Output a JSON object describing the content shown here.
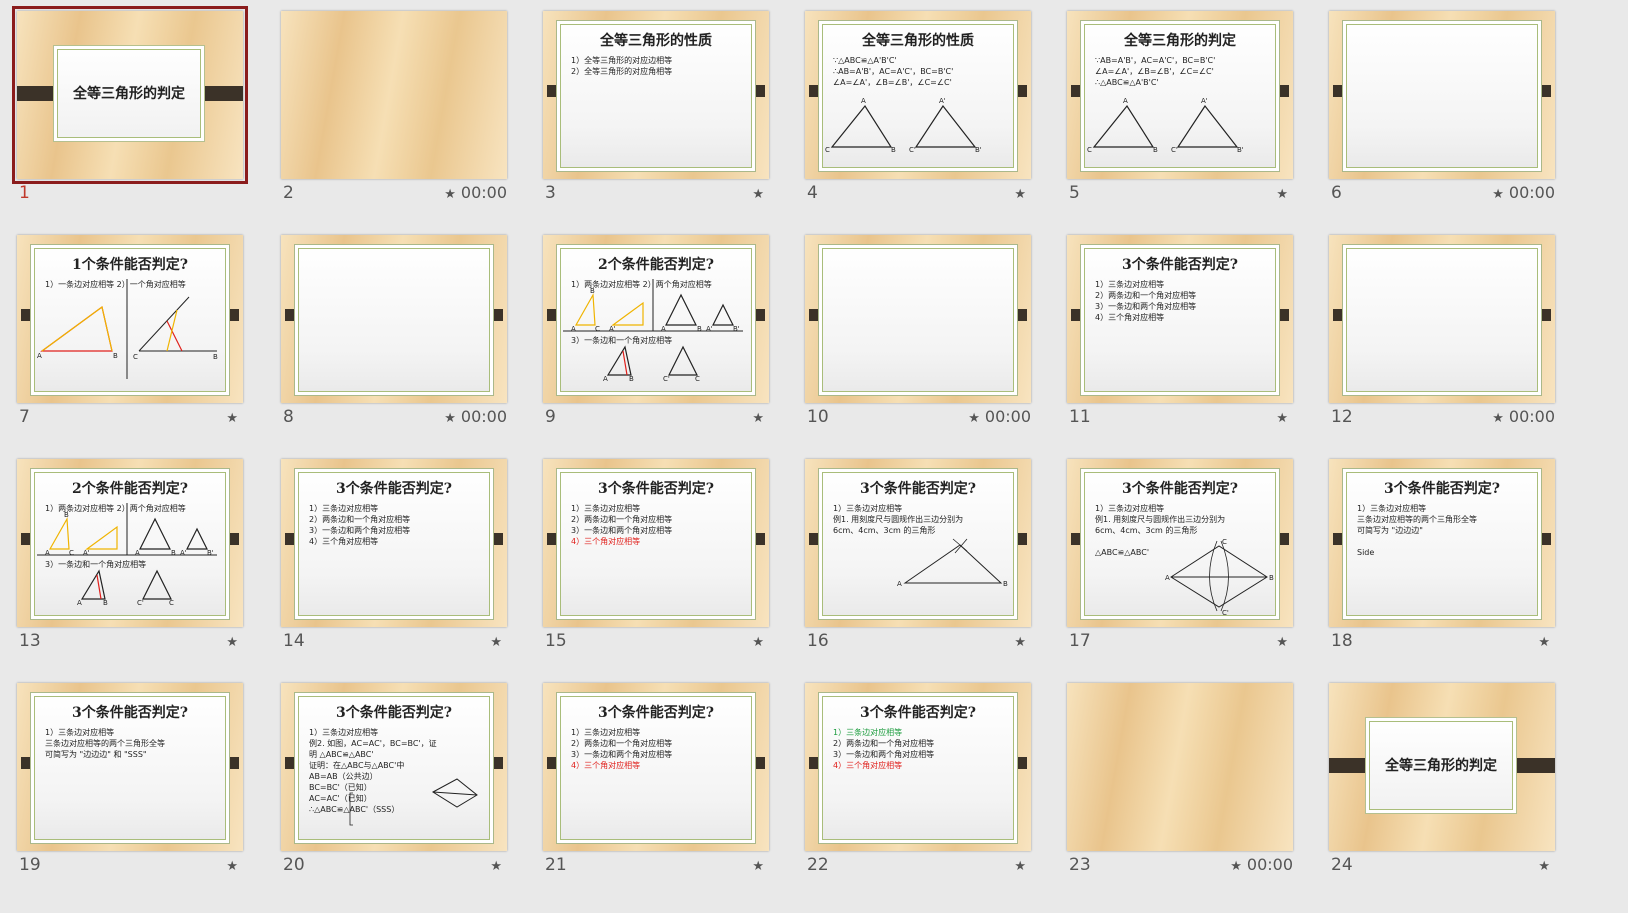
{
  "colors": {
    "selected_border": "#8b1c1c",
    "highlight_red": "#e0201c",
    "highlight_green": "#1a9b3c"
  },
  "slides": [
    {
      "num": "1",
      "kind": "cover",
      "title": "全等三角形的判定",
      "selected": true,
      "timing": "",
      "has_star": false
    },
    {
      "num": "2",
      "kind": "blank",
      "timing": "00:00",
      "has_star": true
    },
    {
      "num": "3",
      "kind": "framed",
      "title": "全等三角形的性质",
      "lines": [
        "1）全等三角形的对应边相等",
        "2）全等三角形的对应角相等"
      ],
      "timing": "",
      "has_star": true
    },
    {
      "num": "4",
      "kind": "framed",
      "title": "全等三角形的性质",
      "lines": [
        "∵△ABC≌△A'B'C'",
        "∴AB=A'B'，AC=A'C'，BC=B'C'",
        "  ∠A=∠A'，∠B=∠B'，∠C=∠C'"
      ],
      "figure": "two_triangles",
      "timing": "",
      "has_star": true
    },
    {
      "num": "5",
      "kind": "framed",
      "title": "全等三角形的判定",
      "lines": [
        "∵AB=A'B'，AC=A'C'，BC=B'C'",
        "  ∠A=∠A'，∠B=∠B'，∠C=∠C'",
        "∴△ABC≌△A'B'C'"
      ],
      "figure": "two_triangles",
      "timing": "",
      "has_star": true
    },
    {
      "num": "6",
      "kind": "frame_empty",
      "timing": "00:00",
      "has_star": true
    },
    {
      "num": "7",
      "kind": "framed",
      "title": "1个条件能否判定?",
      "lines": [
        "1）一条边对应相等  2）一个角对应相等"
      ],
      "figure": "one_condition",
      "timing": "",
      "has_star": true
    },
    {
      "num": "8",
      "kind": "frame_empty",
      "timing": "00:00",
      "has_star": true
    },
    {
      "num": "9",
      "kind": "framed",
      "title": "2个条件能否判定?",
      "lines": [
        "1）两条边对应相等    2）两个角对应相等"
      ],
      "lines2": [
        "3）一条边和一个角对应相等"
      ],
      "figure": "two_conditions",
      "timing": "",
      "has_star": true
    },
    {
      "num": "10",
      "kind": "frame_empty",
      "timing": "00:00",
      "has_star": true
    },
    {
      "num": "11",
      "kind": "framed",
      "title": "3个条件能否判定?",
      "lines": [
        "1）三条边对应相等",
        "2）两条边和一个角对应相等",
        "3）一条边和两个角对应相等",
        "4）三个角对应相等"
      ],
      "timing": "",
      "has_star": true
    },
    {
      "num": "12",
      "kind": "frame_empty",
      "timing": "00:00",
      "has_star": true
    },
    {
      "num": "13",
      "kind": "framed",
      "title": "2个条件能否判定?",
      "lines": [
        "1）两条边对应相等    2）两个角对应相等"
      ],
      "lines2": [
        "3）一条边和一个角对应相等"
      ],
      "figure": "two_conditions",
      "timing": "",
      "has_star": true
    },
    {
      "num": "14",
      "kind": "framed",
      "title": "3个条件能否判定?",
      "lines": [
        "1）三条边对应相等",
        "2）两条边和一个角对应相等",
        "3）一条边和两个角对应相等",
        "4）三个角对应相等"
      ],
      "timing": "",
      "has_star": true
    },
    {
      "num": "15",
      "kind": "framed",
      "title": "3个条件能否判定?",
      "lines": [
        "1）三条边对应相等",
        "2）两条边和一个角对应相等",
        "3）一条边和两个角对应相等",
        "4）三个角对应相等"
      ],
      "red_lines": [
        3
      ],
      "timing": "",
      "has_star": true
    },
    {
      "num": "16",
      "kind": "framed",
      "title": "3个条件能否判定?",
      "lines": [
        "1）三条边对应相等",
        "   例1. 用刻度尺与圆规作出三边分别为",
        "   6cm、4cm、3cm 的三角形"
      ],
      "figure": "construct",
      "timing": "",
      "has_star": true
    },
    {
      "num": "17",
      "kind": "framed",
      "title": "3个条件能否判定?",
      "lines": [
        "1）三条边对应相等",
        "   例1. 用刻度尺与圆规作出三边分别为",
        "   6cm、4cm、3cm 的三角形",
        "",
        "   △ABC≌△ABC'"
      ],
      "figure": "rhombus",
      "timing": "",
      "has_star": true
    },
    {
      "num": "18",
      "kind": "framed",
      "title": "3个条件能否判定?",
      "lines": [
        "1）三条边对应相等",
        "   三条边对应相等的两个三角形全等",
        "   可简写为 \"边边边\"",
        "",
        "   Side"
      ],
      "timing": "",
      "has_star": true
    },
    {
      "num": "19",
      "kind": "framed",
      "title": "3个条件能否判定?",
      "lines": [
        "1）三条边对应相等",
        "   三条边对应相等的两个三角形全等",
        "   可简写为 \"边边边\" 和 \"SSS\""
      ],
      "timing": "",
      "has_star": true
    },
    {
      "num": "20",
      "kind": "framed",
      "title": "3个条件能否判定?",
      "lines": [
        "1）三条边对应相等",
        "   例2. 如图，AC=AC'，BC=BC'，证",
        "   明 △ABC≌△ABC'",
        "   证明：在△ABC与△ABC'中",
        "      AB=AB（公共边）",
        "      BC=BC'（已知）",
        "      AC=AC'（已知）",
        "   ∴△ABC≌△ABC'（SSS）"
      ],
      "figure": "small_rhombus",
      "timing": "",
      "has_star": true
    },
    {
      "num": "21",
      "kind": "framed",
      "title": "3个条件能否判定?",
      "lines": [
        "1）三条边对应相等",
        "2）两条边和一个角对应相等",
        "3）一条边和两个角对应相等",
        "4）三个角对应相等"
      ],
      "red_lines": [
        3
      ],
      "timing": "",
      "has_star": true
    },
    {
      "num": "22",
      "kind": "framed",
      "title": "3个条件能否判定?",
      "lines": [
        "1）三条边对应相等",
        "2）两条边和一个角对应相等",
        "3）一条边和两个角对应相等",
        "4）三个角对应相等"
      ],
      "green_lines": [
        0
      ],
      "red_lines": [
        3
      ],
      "timing": "",
      "has_star": true
    },
    {
      "num": "23",
      "kind": "blank",
      "timing": "00:00",
      "has_star": true
    },
    {
      "num": "24",
      "kind": "cover",
      "title": "全等三角形的判定",
      "selected": false,
      "timing": "",
      "has_star": true
    }
  ]
}
